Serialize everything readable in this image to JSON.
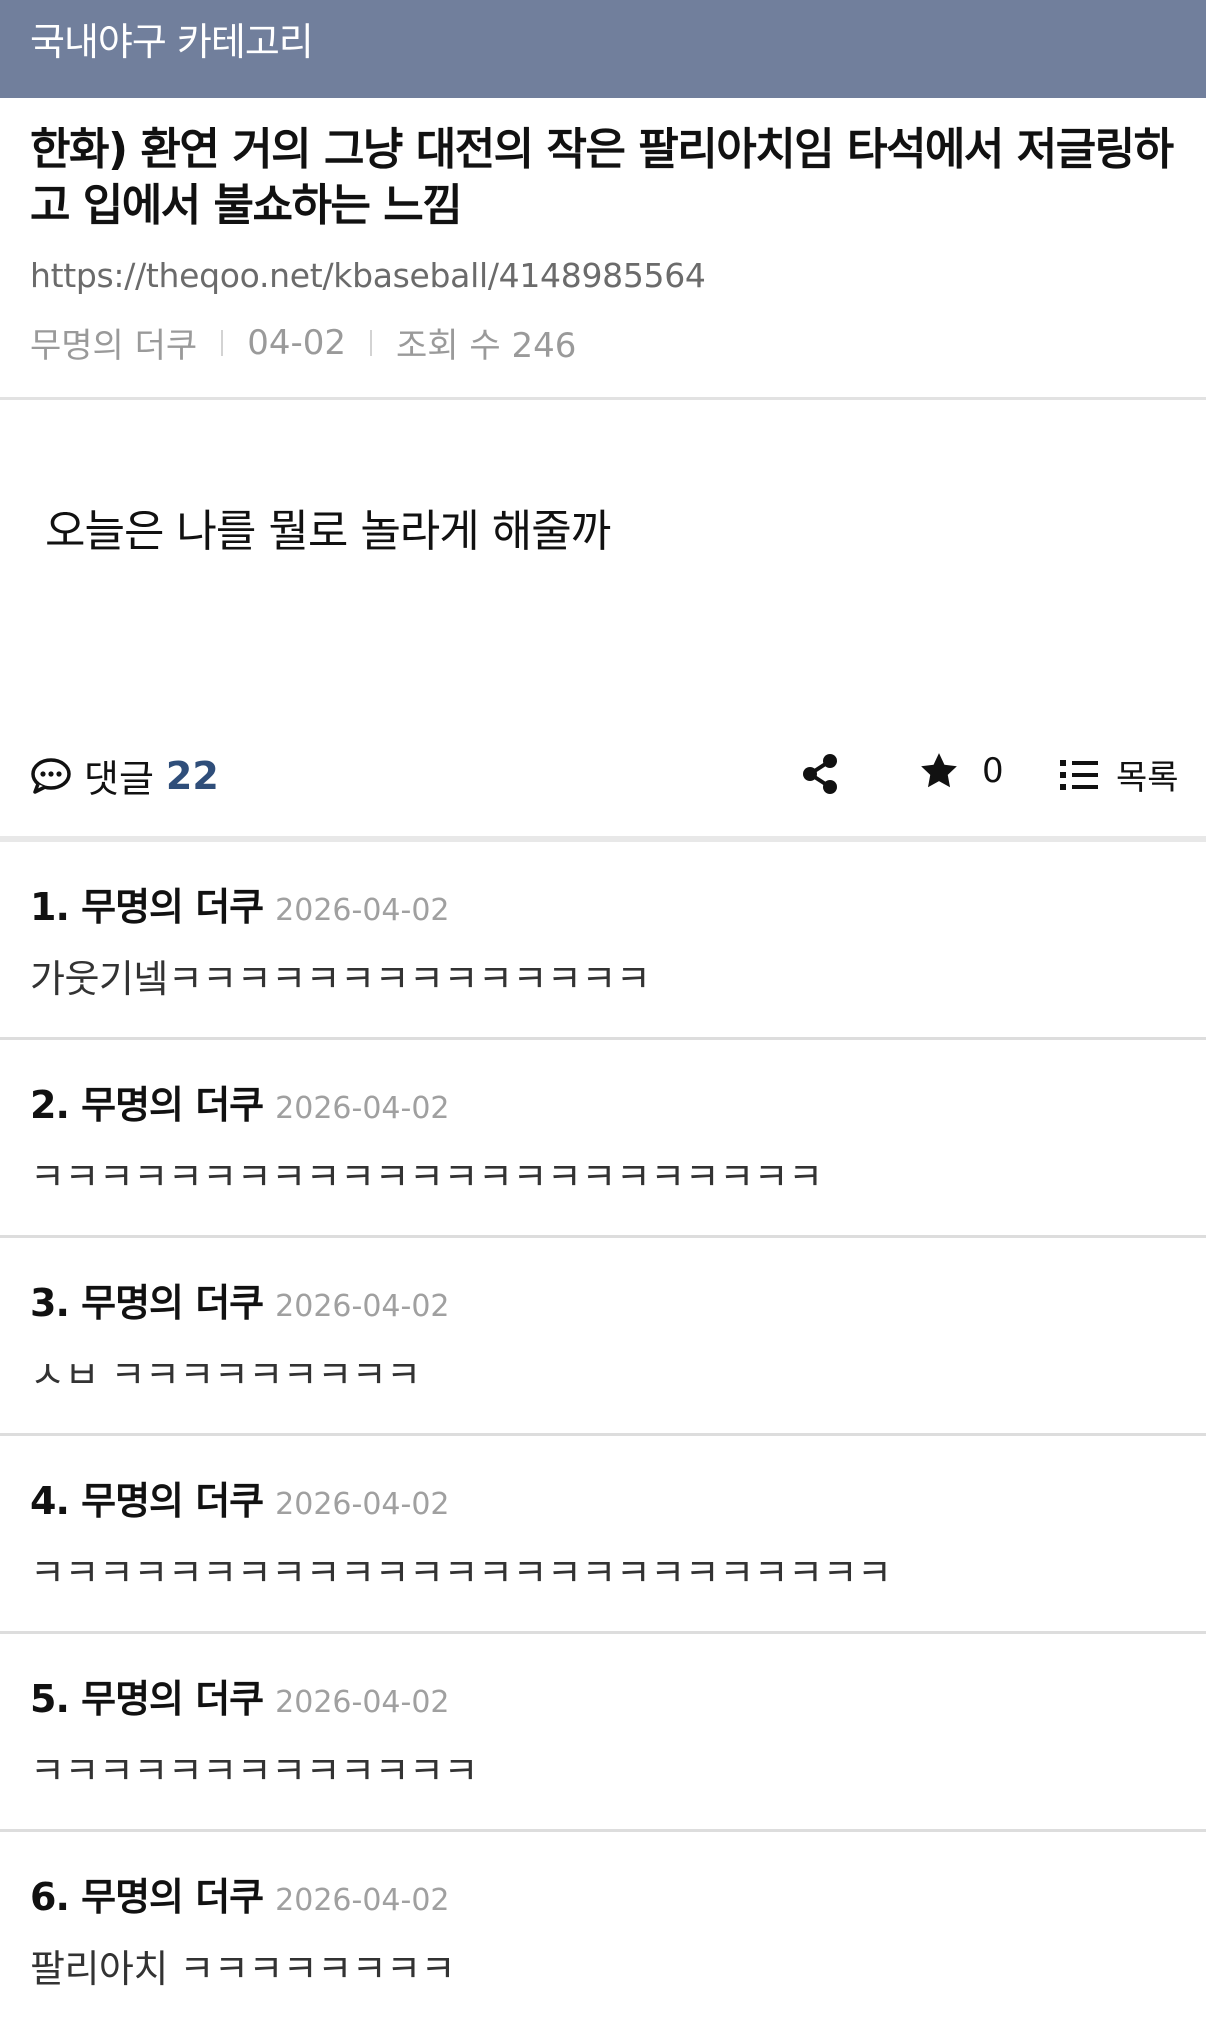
{
  "category": {
    "label": "국내야구 카테고리"
  },
  "post": {
    "title": "한화) 환연 거의 그냥 대전의 작은 팔리아치임 타석에서 저글링하고 입에서 불쇼하는 느낌",
    "url": "https://theqoo.net/kbaseball/4148985564",
    "author": "무명의 더쿠",
    "date": "04-02",
    "views": "조회 수 246",
    "body": "오늘은 나를 뭘로 놀라게 해줄까"
  },
  "actions": {
    "comment_label": "댓글",
    "comment_count": "22",
    "star_count": "0",
    "list_label": "목록"
  },
  "icons": [
    "speech-bubble-icon",
    "share-icon",
    "star-icon",
    "list-icon"
  ],
  "colors": {
    "category_bar": "#717f9c",
    "comment_count": "#2f4e7a"
  },
  "comments": [
    {
      "head": "1. 무명의 더쿠",
      "date": "2026-04-02",
      "text": "가웃기넼ㅋㅋㅋㅋㅋㅋㅋㅋㅋㅋㅋㅋㅋㅋ"
    },
    {
      "head": "2. 무명의 더쿠",
      "date": "2026-04-02",
      "text": "ㅋㅋㅋㅋㅋㅋㅋㅋㅋㅋㅋㅋㅋㅋㅋㅋㅋㅋㅋㅋㅋㅋㅋ"
    },
    {
      "head": "3. 무명의 더쿠",
      "date": "2026-04-02",
      "text": "ㅅㅂ ㅋㅋㅋㅋㅋㅋㅋㅋㅋ"
    },
    {
      "head": "4. 무명의 더쿠",
      "date": "2026-04-02",
      "text": "ㅋㅋㅋㅋㅋㅋㅋㅋㅋㅋㅋㅋㅋㅋㅋㅋㅋㅋㅋㅋㅋㅋㅋㅋㅋ"
    },
    {
      "head": "5. 무명의 더쿠",
      "date": "2026-04-02",
      "text": "ㅋㅋㅋㅋㅋㅋㅋㅋㅋㅋㅋㅋㅋ"
    },
    {
      "head": "6. 무명의 더쿠",
      "date": "2026-04-02",
      "text": "팔리아치 ㅋㅋㅋㅋㅋㅋㅋㅋ"
    }
  ]
}
